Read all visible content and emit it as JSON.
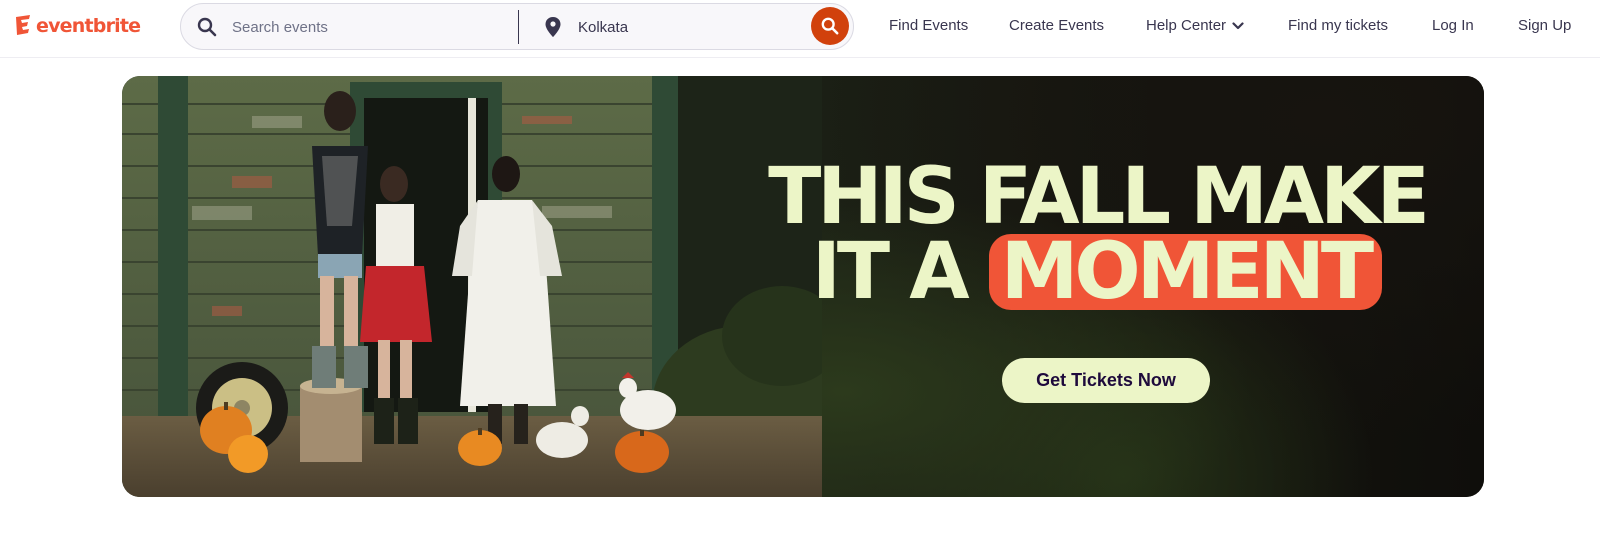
{
  "brand": {
    "logo_text": "eventbrite",
    "accent_color": "#f05537",
    "search_button_color": "#d1410c",
    "cta_color": "#ecf5c7"
  },
  "search": {
    "placeholder": "Search events",
    "icon": "search-icon",
    "location_value": "Kolkata",
    "location_icon": "map-pin-icon",
    "submit_icon": "search-icon"
  },
  "nav": {
    "items": [
      {
        "label": "Find Events"
      },
      {
        "label": "Create Events"
      },
      {
        "label": "Help Center",
        "icon": "chevron-down-icon"
      },
      {
        "label": "Find my tickets"
      },
      {
        "label": "Log In"
      },
      {
        "label": "Sign Up"
      }
    ]
  },
  "hero": {
    "headline_line1": "THIS FALL MAKE",
    "headline_line2_prefix": "IT A",
    "headline_highlight": "MOMENT",
    "cta_label": "Get Tickets Now"
  }
}
